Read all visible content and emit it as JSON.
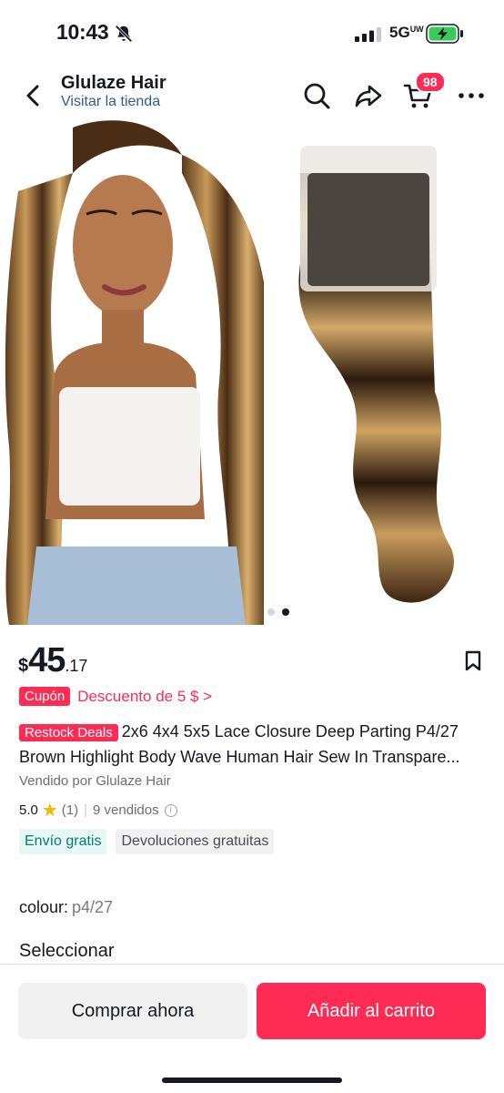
{
  "status_bar": {
    "time": "10:43",
    "network": "5G",
    "network_sub": "UW"
  },
  "header": {
    "store_name": "Glulaze Hair",
    "store_link": "Visitar la tienda",
    "cart_count": "98",
    "icons": [
      "back-arrow-icon",
      "search-icon",
      "share-icon",
      "cart-icon",
      "more-icon"
    ]
  },
  "gallery": {
    "current_index": 2,
    "total": 2
  },
  "product": {
    "price_currency": "$",
    "price_integer": "45",
    "price_decimal": ".17",
    "coupon_tag": "Cupón",
    "coupon_text": "Descuento de 5 $ >",
    "deal_tag": "Restock Deals",
    "title_line1": "2x6 4x4 5x5 Lace Closure Deep Parting P4/27",
    "title_line2": "Brown Highlight Body Wave Human Hair Sew In Transpare...",
    "seller": "Vendido por Glulaze Hair",
    "rating": "5.0",
    "rating_count": "(1)",
    "sold": "9 vendidos",
    "chip_shipping": "Envío gratis",
    "chip_returns": "Devoluciones gratuitas",
    "colour_label": "colour:",
    "colour_value": "p4/27",
    "select_label": "Seleccionar"
  },
  "actions": {
    "buy_now": "Comprar ahora",
    "add_to_cart": "Añadir al carrito"
  },
  "colors": {
    "accent": "#fe2c55",
    "link": "#2d5a9a",
    "green_chip": "#0b7b6b"
  }
}
